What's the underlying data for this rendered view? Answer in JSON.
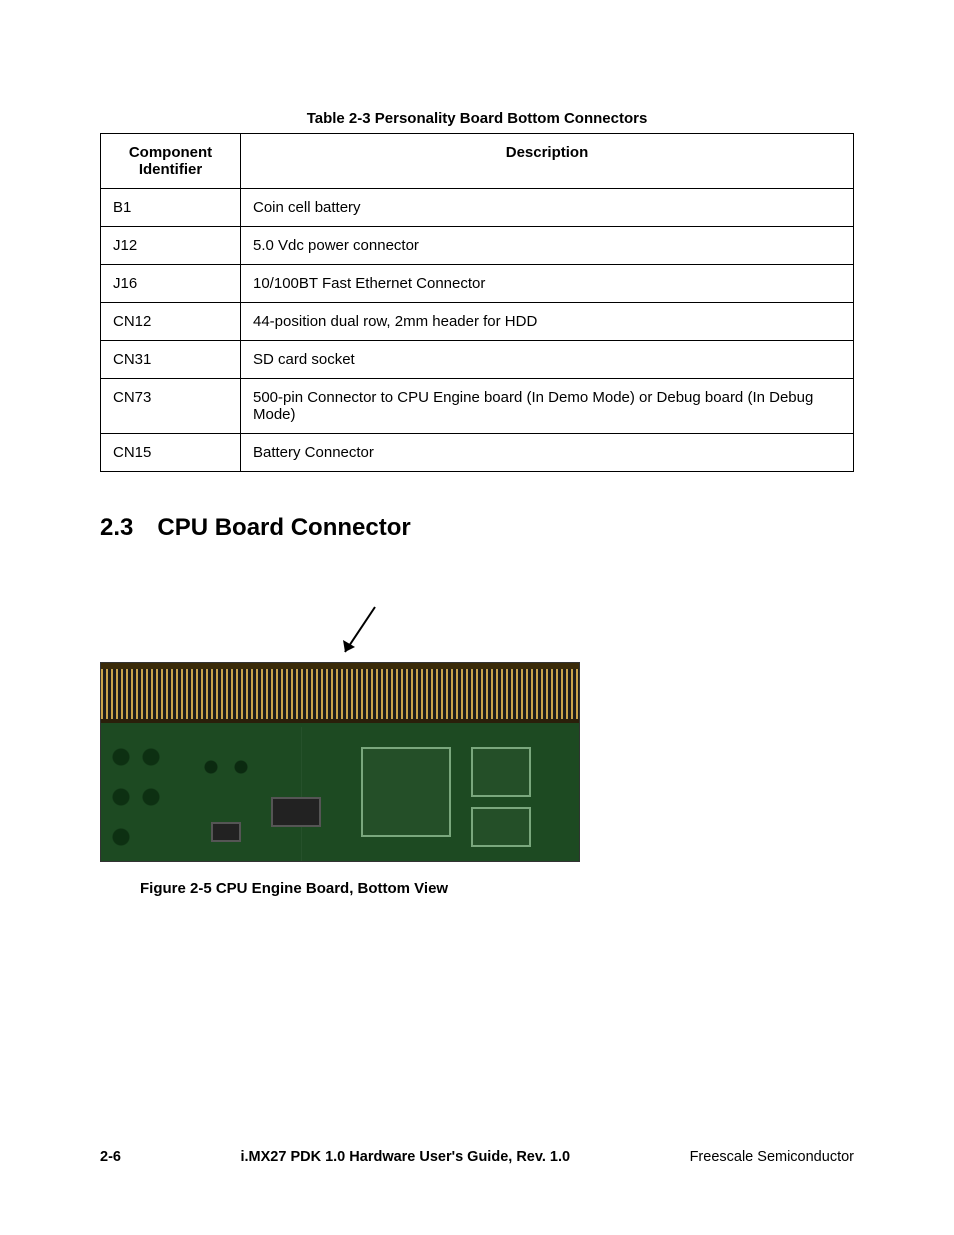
{
  "table": {
    "caption": "Table 2-3 Personality Board Bottom Connectors",
    "headers": {
      "id": "Component Identifier",
      "desc": "Description"
    },
    "rows": [
      {
        "id": "B1",
        "desc": "Coin cell battery"
      },
      {
        "id": "J12",
        "desc": "5.0 Vdc power connector"
      },
      {
        "id": "J16",
        "desc": "10/100BT Fast Ethernet Connector"
      },
      {
        "id": "CN12",
        "desc": "44-position dual row, 2mm header for HDD"
      },
      {
        "id": "CN31",
        "desc": "SD card socket"
      },
      {
        "id": "CN73",
        "desc": "500-pin Connector to CPU Engine board (In Demo Mode) or Debug board (In Debug Mode)"
      },
      {
        "id": "CN15",
        "desc": "Battery Connector"
      }
    ]
  },
  "section": {
    "number": "2.3",
    "title": "CPU Board Connector"
  },
  "figure": {
    "caption": "Figure 2-5 CPU Engine Board, Bottom View"
  },
  "footer": {
    "page": "2-6",
    "docTitle": "i.MX27 PDK 1.0 Hardware User's Guide, Rev. 1.0",
    "company": "Freescale Semiconductor"
  }
}
